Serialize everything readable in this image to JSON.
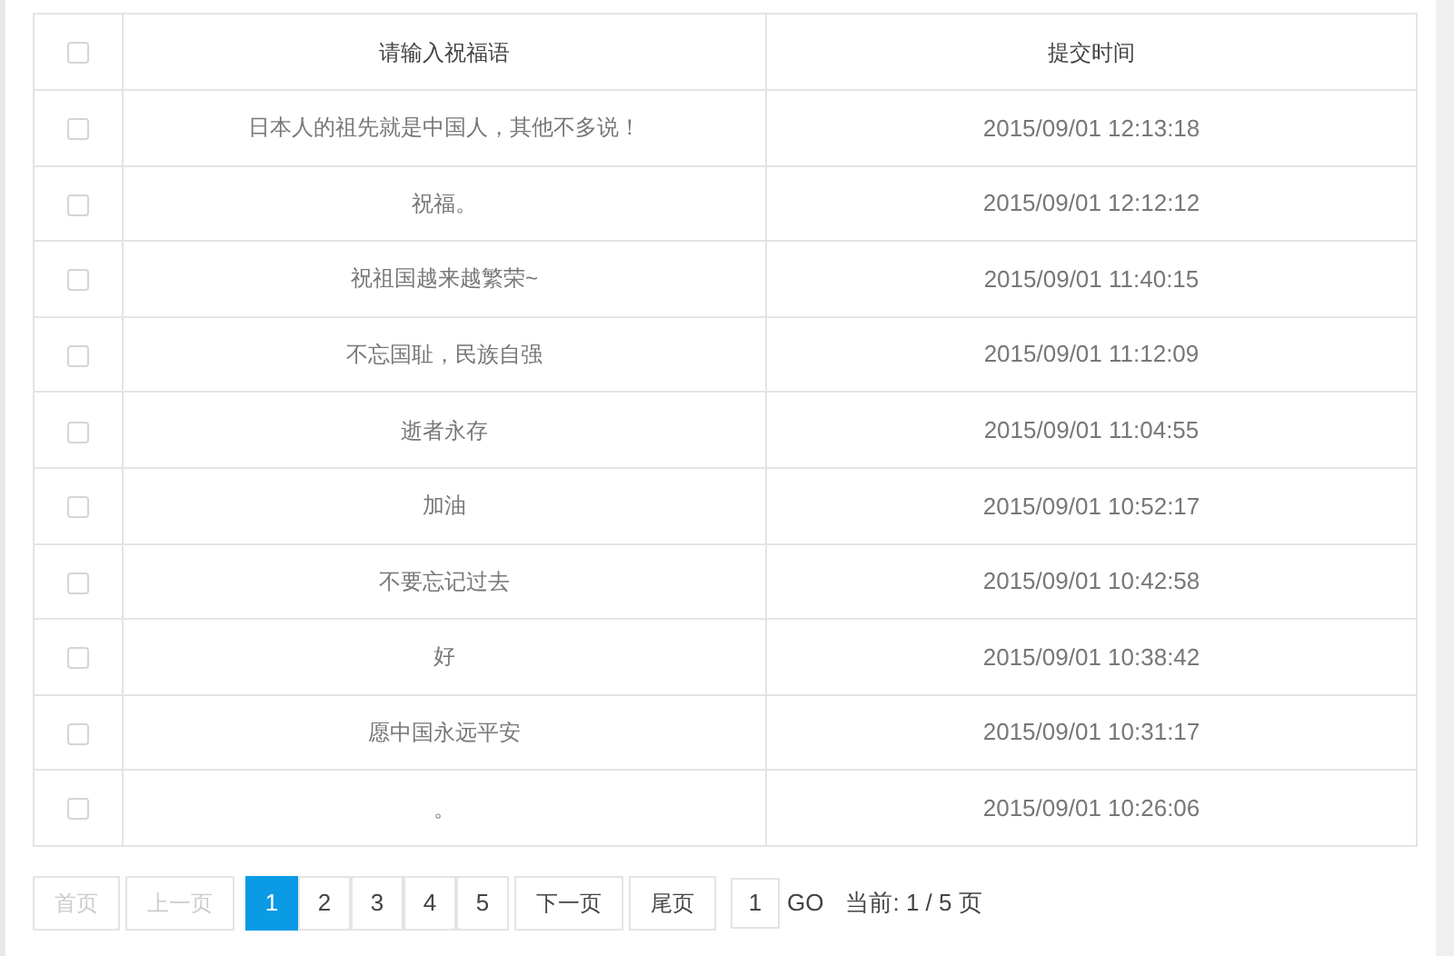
{
  "table": {
    "header_checkbox": {
      "checked": false
    },
    "columns": [
      "请输入祝福语",
      "提交时间"
    ],
    "rows": [
      {
        "checked": false,
        "message": "日本人的祖先就是中国人，其他不多说！",
        "time": "2015/09/01 12:13:18"
      },
      {
        "checked": false,
        "message": "祝福。",
        "time": "2015/09/01 12:12:12"
      },
      {
        "checked": false,
        "message": "祝祖国越来越繁荣~",
        "time": "2015/09/01 11:40:15"
      },
      {
        "checked": false,
        "message": "不忘国耻，民族自强",
        "time": "2015/09/01 11:12:09"
      },
      {
        "checked": false,
        "message": "逝者永存",
        "time": "2015/09/01 11:04:55"
      },
      {
        "checked": false,
        "message": "加油",
        "time": "2015/09/01 10:52:17"
      },
      {
        "checked": false,
        "message": "不要忘记过去",
        "time": "2015/09/01 10:42:58"
      },
      {
        "checked": false,
        "message": "好",
        "time": "2015/09/01 10:38:42"
      },
      {
        "checked": false,
        "message": "愿中国永远平安",
        "time": "2015/09/01 10:31:17"
      },
      {
        "checked": false,
        "message": "。",
        "time": "2015/09/01 10:26:06"
      }
    ]
  },
  "pagination": {
    "buttons": [
      {
        "kind": "nav",
        "label": "首页",
        "disabled": true
      },
      {
        "kind": "nav",
        "label": "上一页",
        "disabled": true
      },
      {
        "kind": "page",
        "label": "1",
        "selected": true
      },
      {
        "kind": "page",
        "label": "2",
        "selected": false
      },
      {
        "kind": "page",
        "label": "3",
        "selected": false
      },
      {
        "kind": "page",
        "label": "4",
        "selected": false
      },
      {
        "kind": "page",
        "label": "5",
        "selected": false
      },
      {
        "kind": "nav",
        "label": "下一页",
        "disabled": false
      },
      {
        "kind": "nav",
        "label": "尾页",
        "disabled": false
      }
    ],
    "page_input": {
      "value": "1"
    },
    "go_label": "GO",
    "status": "当前: 1 / 5 页"
  }
}
